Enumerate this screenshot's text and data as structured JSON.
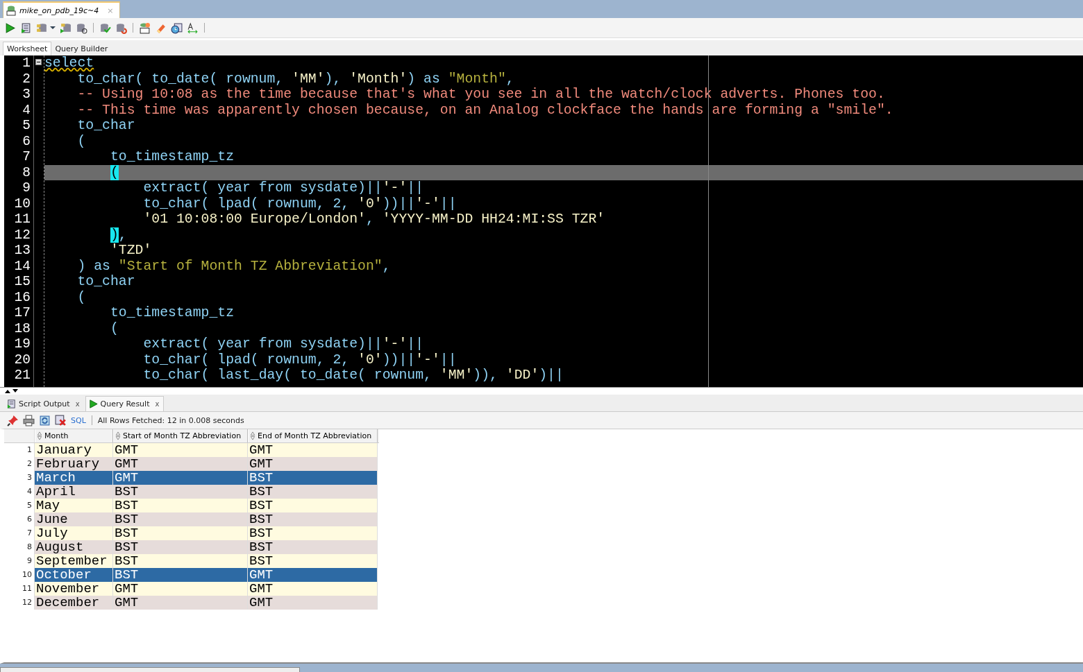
{
  "document_tab": {
    "title": "mike_on_pdb_19c~4",
    "close": "×"
  },
  "editor_tabs": [
    {
      "label": "Worksheet",
      "selected": true
    },
    {
      "label": "Query Builder",
      "selected": false
    }
  ],
  "code_lines": [
    {
      "number": "1",
      "current": false,
      "tokens": [
        {
          "kind": "warn",
          "text": "select"
        }
      ],
      "children": [
        {
          "number": "2",
          "current": false,
          "tokens": [
            {
              "kind": "fn",
              "text": "to_char( to_date( rownum, "
            },
            {
              "kind": "str",
              "text": "'MM'"
            },
            {
              "kind": "fn",
              "text": "), "
            },
            {
              "kind": "str",
              "text": "'Month'"
            },
            {
              "kind": "fn",
              "text": ") as "
            },
            {
              "kind": "alias",
              "text": "\"Month\""
            },
            {
              "kind": "fn",
              "text": ","
            }
          ]
        },
        {
          "number": "3",
          "current": false,
          "tokens": [
            {
              "kind": "comment",
              "text": "-- Using 10:08 as the time because that's what you see in all the watch/clock adverts. Phones too."
            }
          ]
        },
        {
          "number": "4",
          "current": false,
          "tokens": [
            {
              "kind": "comment",
              "text": "-- This time was apparently chosen because, on an Analog clockface the hands are forming a \"smile\"."
            }
          ]
        },
        {
          "number": "5",
          "current": false,
          "tokens": [
            {
              "kind": "fn",
              "text": "to_char"
            }
          ]
        },
        {
          "number": "6",
          "current": false,
          "tokens": [
            {
              "kind": "fn",
              "text": "("
            }
          ],
          "children": [
            {
              "number": "7",
              "current": false,
              "tokens": [
                {
                  "kind": "fn",
                  "text": "to_timestamp_tz"
                }
              ]
            },
            {
              "number": "8",
              "current": true,
              "tokens": [
                {
                  "kind": "match",
                  "text": "("
                }
              ],
              "children": [
                {
                  "number": "9",
                  "current": false,
                  "tokens": [
                    {
                      "kind": "fn",
                      "text": "extract( year from sysdate)||"
                    },
                    {
                      "kind": "str",
                      "text": "'-'"
                    },
                    {
                      "kind": "fn",
                      "text": "||"
                    }
                  ]
                },
                {
                  "number": "10",
                  "current": false,
                  "tokens": [
                    {
                      "kind": "fn",
                      "text": "to_char( lpad( rownum, 2, "
                    },
                    {
                      "kind": "str",
                      "text": "'0'"
                    },
                    {
                      "kind": "fn",
                      "text": "))||"
                    },
                    {
                      "kind": "str",
                      "text": "'-'"
                    },
                    {
                      "kind": "fn",
                      "text": "||"
                    }
                  ]
                },
                {
                  "number": "11",
                  "current": false,
                  "tokens": [
                    {
                      "kind": "str",
                      "text": "'01 10:08:00 Europe/London'"
                    },
                    {
                      "kind": "fn",
                      "text": ", "
                    },
                    {
                      "kind": "str",
                      "text": "'YYYY-MM-DD HH24:MI:SS TZR'"
                    }
                  ]
                }
              ]
            },
            {
              "number": "12",
              "current": false,
              "tokens": [
                {
                  "kind": "match",
                  "text": ")"
                },
                {
                  "kind": "fn",
                  "text": ","
                }
              ]
            },
            {
              "number": "13",
              "current": false,
              "tokens": [
                {
                  "kind": "str",
                  "text": "'TZD'"
                }
              ]
            }
          ]
        },
        {
          "number": "14",
          "current": false,
          "tokens": [
            {
              "kind": "fn",
              "text": ") as "
            },
            {
              "kind": "alias",
              "text": "\"Start of Month TZ Abbreviation\""
            },
            {
              "kind": "fn",
              "text": ","
            }
          ]
        },
        {
          "number": "15",
          "current": false,
          "tokens": [
            {
              "kind": "fn",
              "text": "to_char"
            }
          ]
        },
        {
          "number": "16",
          "current": false,
          "tokens": [
            {
              "kind": "fn",
              "text": "("
            }
          ],
          "children": [
            {
              "number": "17",
              "current": false,
              "tokens": [
                {
                  "kind": "fn",
                  "text": "to_timestamp_tz"
                }
              ]
            },
            {
              "number": "18",
              "current": false,
              "tokens": [
                {
                  "kind": "fn",
                  "text": "("
                }
              ],
              "children": [
                {
                  "number": "19",
                  "current": false,
                  "tokens": [
                    {
                      "kind": "fn",
                      "text": "extract( year from sysdate)||"
                    },
                    {
                      "kind": "str",
                      "text": "'-'"
                    },
                    {
                      "kind": "fn",
                      "text": "||"
                    }
                  ]
                },
                {
                  "number": "20",
                  "current": false,
                  "tokens": [
                    {
                      "kind": "fn",
                      "text": "to_char( lpad( rownum, 2, "
                    },
                    {
                      "kind": "str",
                      "text": "'0'"
                    },
                    {
                      "kind": "fn",
                      "text": "))||"
                    },
                    {
                      "kind": "str",
                      "text": "'-'"
                    },
                    {
                      "kind": "fn",
                      "text": "||"
                    }
                  ]
                },
                {
                  "number": "21",
                  "current": false,
                  "tokens": [
                    {
                      "kind": "fn",
                      "text": "to_char( last_day( to_date( rownum, "
                    },
                    {
                      "kind": "str",
                      "text": "'MM'"
                    },
                    {
                      "kind": "fn",
                      "text": ")), "
                    },
                    {
                      "kind": "str",
                      "text": "'DD'"
                    },
                    {
                      "kind": "fn",
                      "text": ")||"
                    }
                  ]
                }
              ]
            }
          ]
        }
      ]
    }
  ],
  "result_tabs": [
    {
      "label": "Script Output",
      "close": "x",
      "selected": false
    },
    {
      "label": "Query Result",
      "close": "x",
      "selected": true
    }
  ],
  "result_toolbar": {
    "sql_link": "SQL",
    "status": "All Rows Fetched: 12 in 0.008 seconds"
  },
  "table": {
    "columns": [
      "Month",
      "Start of Month TZ Abbreviation",
      "End of Month TZ Abbreviation"
    ],
    "rows": [
      {
        "number": "1",
        "cells": [
          "January",
          "GMT",
          "GMT"
        ],
        "selected": false
      },
      {
        "number": "2",
        "cells": [
          "February",
          "GMT",
          "GMT"
        ],
        "selected": false
      },
      {
        "number": "3",
        "cells": [
          "March",
          "GMT",
          "BST"
        ],
        "selected": true
      },
      {
        "number": "4",
        "cells": [
          "April",
          "BST",
          "BST"
        ],
        "selected": false
      },
      {
        "number": "5",
        "cells": [
          "May",
          "BST",
          "BST"
        ],
        "selected": false
      },
      {
        "number": "6",
        "cells": [
          "June",
          "BST",
          "BST"
        ],
        "selected": false
      },
      {
        "number": "7",
        "cells": [
          "July",
          "BST",
          "BST"
        ],
        "selected": false
      },
      {
        "number": "8",
        "cells": [
          "August",
          "BST",
          "BST"
        ],
        "selected": false
      },
      {
        "number": "9",
        "cells": [
          "September",
          "BST",
          "BST"
        ],
        "selected": false
      },
      {
        "number": "10",
        "cells": [
          "October",
          "BST",
          "GMT"
        ],
        "selected": true
      },
      {
        "number": "11",
        "cells": [
          "November",
          "GMT",
          "GMT"
        ],
        "selected": false
      },
      {
        "number": "12",
        "cells": [
          "December",
          "GMT",
          "GMT"
        ],
        "selected": false
      }
    ]
  }
}
